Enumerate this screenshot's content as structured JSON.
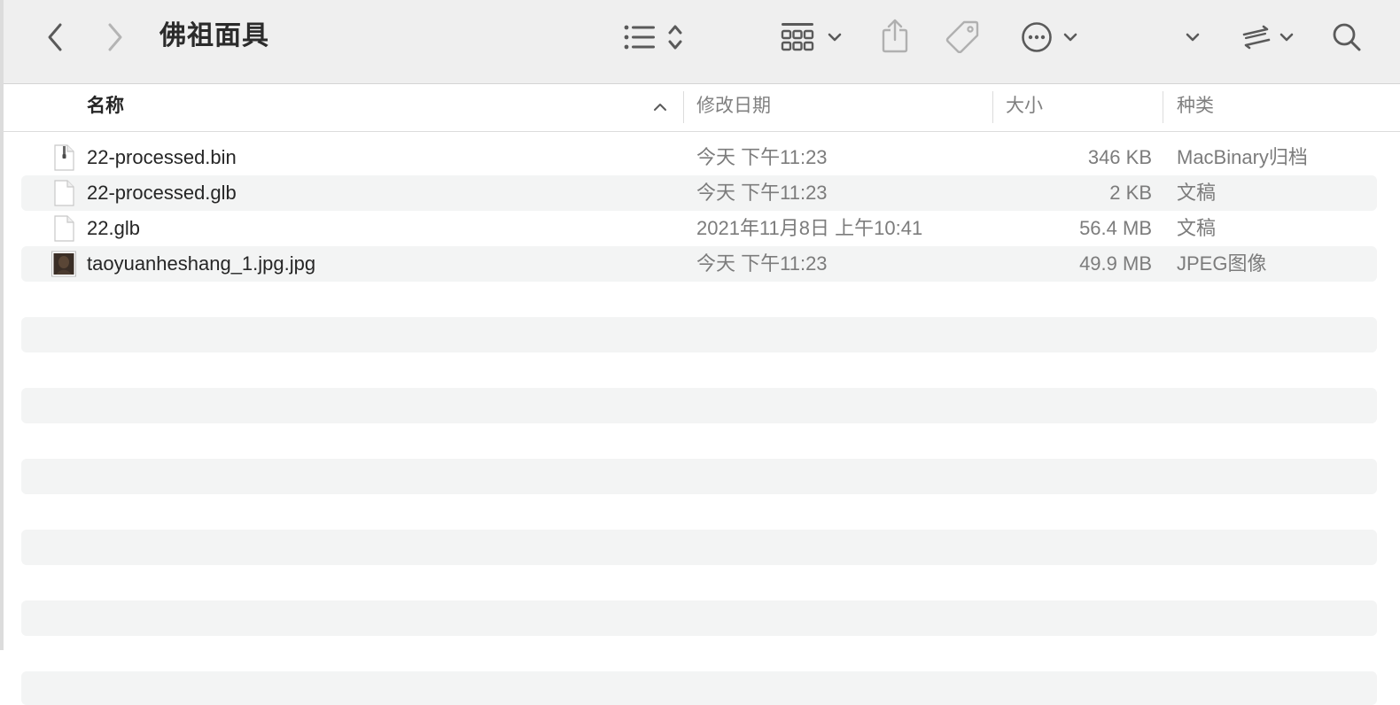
{
  "toolbar": {
    "title": "佛祖面具",
    "icons": [
      "back-chevron-icon",
      "forward-chevron-icon",
      "list-view-icon",
      "sort-updown-icon",
      "grid-group-icon",
      "chevron-down-icon",
      "share-icon",
      "tag-icon",
      "more-icon",
      "chevron-down-icon",
      "sync-icon",
      "search-icon"
    ]
  },
  "columns": {
    "name": "名称",
    "modified": "修改日期",
    "size": "大小",
    "kind": "种类"
  },
  "files": [
    {
      "name": "22-processed.bin",
      "modified": "今天 下午11:23",
      "size": "346 KB",
      "kind": "MacBinary归档",
      "icon": "archive-file-icon"
    },
    {
      "name": "22-processed.glb",
      "modified": "今天 下午11:23",
      "size": "2 KB",
      "kind": "文稿",
      "icon": "document-file-icon"
    },
    {
      "name": "22.glb",
      "modified": "2021年11月8日 上午10:41",
      "size": "56.4 MB",
      "kind": "文稿",
      "icon": "document-file-icon"
    },
    {
      "name": "taoyuanheshang_1.jpg.jpg",
      "modified": "今天 下午11:23",
      "size": "49.9 MB",
      "kind": "JPEG图像",
      "icon": "image-thumbnail-icon"
    }
  ],
  "colors": {
    "toolbar_bg": "#efefef",
    "stripe": "#f3f4f4",
    "text_primary": "#262626",
    "text_secondary": "#7c7c7c"
  }
}
